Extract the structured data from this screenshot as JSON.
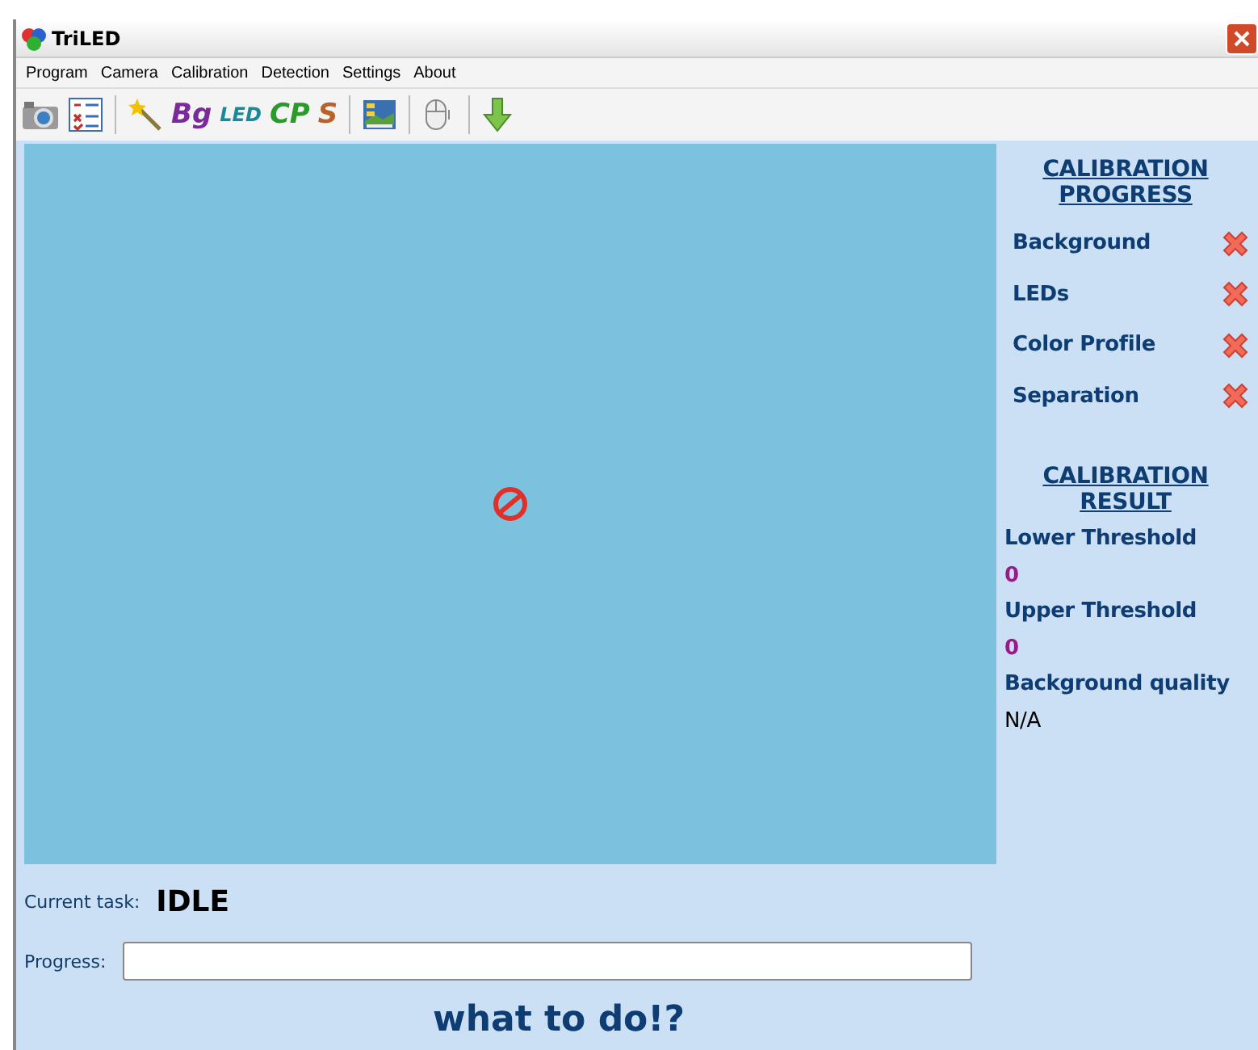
{
  "window": {
    "title": "TriLED"
  },
  "menu": [
    "Program",
    "Camera",
    "Calibration",
    "Detection",
    "Settings",
    "About"
  ],
  "toolbar": [
    {
      "kind": "camera"
    },
    {
      "kind": "checklist"
    },
    {
      "kind": "separator"
    },
    {
      "kind": "wand"
    },
    {
      "kind": "text",
      "label": "Bg",
      "color": "#7a2a9a"
    },
    {
      "kind": "text",
      "label": "LED",
      "color": "#1a8a9a"
    },
    {
      "kind": "text",
      "label": "CP",
      "color": "#2a9a2a"
    },
    {
      "kind": "text",
      "label": "S",
      "color": "#b8622a"
    },
    {
      "kind": "separator"
    },
    {
      "kind": "picture"
    },
    {
      "kind": "separator"
    },
    {
      "kind": "mouse"
    },
    {
      "kind": "separator"
    },
    {
      "kind": "arrow"
    }
  ],
  "calibration_progress": {
    "title": "CALIBRATION PROGRESS",
    "steps": [
      {
        "name": "Background",
        "done": false
      },
      {
        "name": "LEDs",
        "done": false
      },
      {
        "name": "Color Profile",
        "done": false
      },
      {
        "name": "Separation",
        "done": false
      }
    ]
  },
  "calibration_result": {
    "title": "CALIBRATION RESULT",
    "items": [
      {
        "label": "Lower Threshold",
        "value": "0",
        "kind": "number"
      },
      {
        "label": "Upper Threshold",
        "value": "0",
        "kind": "number"
      },
      {
        "label": "Background quality",
        "value": "N/A",
        "kind": "text"
      }
    ]
  },
  "current_task": {
    "label": "Current task:",
    "value": "IDLE"
  },
  "progress": {
    "label": "Progress:",
    "level": 0
  },
  "hint": "what to do!?"
}
